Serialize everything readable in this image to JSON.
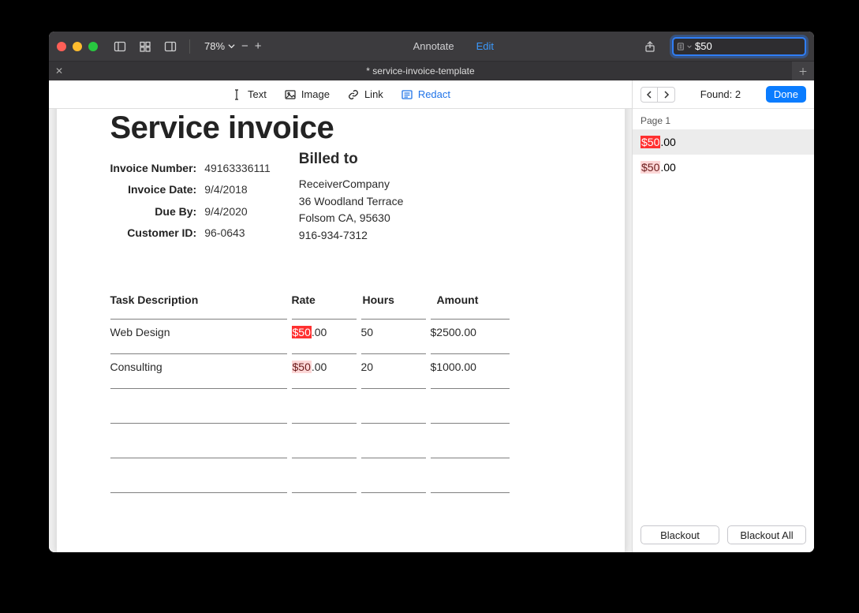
{
  "toolbar": {
    "zoom_pct": "78%",
    "annotate_label": "Annotate",
    "edit_label": "Edit",
    "search_value": "$50"
  },
  "tab": {
    "title": "* service-invoice-template"
  },
  "subtoolbar": {
    "text_label": "Text",
    "image_label": "Image",
    "link_label": "Link",
    "redact_label": "Redact"
  },
  "sidepanel": {
    "found_label": "Found: 2",
    "done_label": "Done",
    "page_label": "Page 1",
    "results": [
      {
        "match": "$50",
        "rest": ".00",
        "selected": true
      },
      {
        "match": "$50",
        "rest": ".00",
        "selected": false
      }
    ],
    "blackout_label": "Blackout",
    "blackout_all_label": "Blackout All"
  },
  "doc": {
    "heading": "Service invoice",
    "meta": {
      "invoice_number_label": "Invoice Number:",
      "invoice_number": "49163336111",
      "invoice_date_label": "Invoice Date:",
      "invoice_date": "9/4/2018",
      "due_by_label": "Due By:",
      "due_by": "9/4/2020",
      "customer_id_label": "Customer ID:",
      "customer_id": "96-0643"
    },
    "billed": {
      "heading": "Billed to",
      "company": "ReceiverCompany",
      "street": "36 Woodland Terrace",
      "city": "Folsom CA, 95630",
      "phone": "916-934-7312"
    },
    "columns": {
      "desc": "Task Description",
      "rate": "Rate",
      "hours": "Hours",
      "amount": "Amount"
    },
    "rows": [
      {
        "desc": "Web Design",
        "rate_match": "$50",
        "rate_rest": ".00",
        "hours": "50",
        "amount": "$2500.00",
        "current": true
      },
      {
        "desc": "Consulting",
        "rate_match": "$50",
        "rate_rest": ".00",
        "hours": "20",
        "amount": "$1000.00",
        "current": false
      }
    ]
  }
}
